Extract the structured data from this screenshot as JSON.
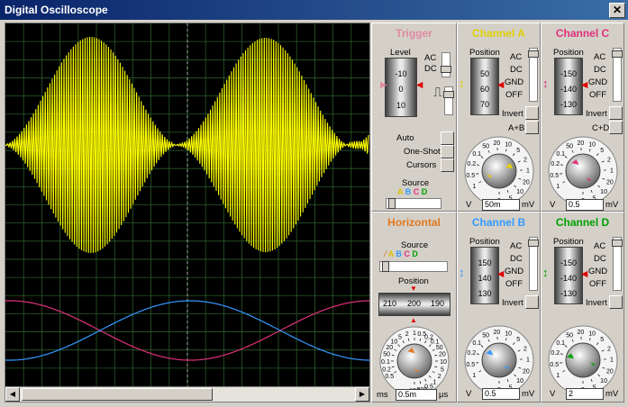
{
  "window": {
    "title": "Digital Oscilloscope",
    "close_glyph": "✕"
  },
  "colors": {
    "a": "#ffff00",
    "b": "#3399ff",
    "c": "#e0307a",
    "d": "#00a000",
    "trigger": "#e08aa0",
    "horizontal": "#e07820",
    "grid": "#2a5a2a"
  },
  "trigger": {
    "title": "Trigger",
    "level_label": "Level",
    "drum_values": [
      "-10",
      "0",
      "10"
    ],
    "ac": "AC",
    "dc": "DC",
    "auto": "Auto",
    "oneshot": "One-Shot",
    "cursors": "Cursors",
    "source_label": "Source",
    "sources": [
      "A",
      "B",
      "C",
      "D"
    ]
  },
  "channel_a": {
    "title": "Channel A",
    "position_label": "Position",
    "drum_values": [
      "50",
      "60",
      "70"
    ],
    "ac": "AC",
    "dc": "DC",
    "gnd": "GND",
    "off": "OFF",
    "invert": "Invert",
    "combine": "A+B",
    "dial_scale": [
      "1",
      "0.5",
      "0.2",
      "0.1",
      "50",
      "20",
      "10",
      "5",
      "2",
      "1",
      "20",
      "10",
      "5",
      "2"
    ],
    "unit_left": "V",
    "unit_right": "mV",
    "value": "50m"
  },
  "channel_b": {
    "title": "Channel B",
    "position_label": "Position",
    "drum_values": [
      "150",
      "140",
      "130"
    ],
    "ac": "AC",
    "dc": "DC",
    "gnd": "GND",
    "off": "OFF",
    "invert": "Invert",
    "dial_scale": [
      "1",
      "0.5",
      "0.2",
      "0.1",
      "50",
      "20",
      "10",
      "5",
      "2",
      "1",
      "20",
      "10",
      "5",
      "2"
    ],
    "unit_left": "V",
    "unit_right": "mV",
    "value": "0.5"
  },
  "channel_c": {
    "title": "Channel C",
    "position_label": "Position",
    "drum_values": [
      "-150",
      "-140",
      "-130"
    ],
    "ac": "AC",
    "dc": "DC",
    "gnd": "GND",
    "off": "OFF",
    "invert": "Invert",
    "combine": "C+D",
    "dial_scale": [
      "1",
      "0.5",
      "0.2",
      "0.1",
      "50",
      "20",
      "10",
      "5",
      "2",
      "1",
      "20",
      "10",
      "5",
      "2"
    ],
    "unit_left": "V",
    "unit_right": "mV",
    "value": "0.5"
  },
  "channel_d": {
    "title": "Channel D",
    "position_label": "Position",
    "drum_values": [
      "-150",
      "-140",
      "-130"
    ],
    "ac": "AC",
    "dc": "DC",
    "gnd": "GND",
    "off": "OFF",
    "invert": "Invert",
    "dial_scale": [
      "1",
      "0.5",
      "0.2",
      "0.1",
      "50",
      "20",
      "10",
      "5",
      "2",
      "1",
      "20",
      "10",
      "5",
      "2"
    ],
    "unit_left": "V",
    "unit_right": "mV",
    "value": "2"
  },
  "horizontal": {
    "title": "Horizontal",
    "source_label": "Source",
    "sources": [
      "A",
      "B",
      "C",
      "D"
    ],
    "position_label": "Position",
    "drum_values": [
      "210",
      "200",
      "190"
    ],
    "dial_scale": [
      "0.5",
      "0.2",
      "0.1",
      "50",
      "20",
      "10",
      "5",
      "2",
      "1",
      "0.5",
      "0.2",
      "0.1",
      "50",
      "20",
      "10",
      "5",
      "2",
      "1",
      "0.5",
      "200",
      "100"
    ],
    "unit_left": "ms",
    "unit_right": "µs",
    "value": "0.5m"
  },
  "scroll": {
    "left": "◀",
    "right": "▶"
  }
}
